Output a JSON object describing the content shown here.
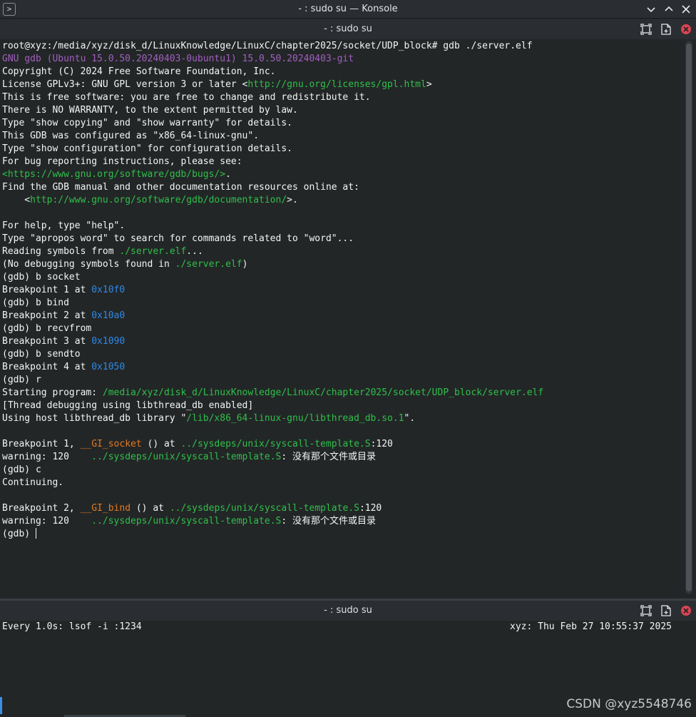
{
  "window": {
    "title": "- : sudo su — Konsole",
    "app_icon": "terminal-icon",
    "app_icon_glyph": ">",
    "buttons": [
      "minimize-icon",
      "maximize-icon",
      "close-icon"
    ]
  },
  "top_pane": {
    "title": "- : sudo su",
    "buttons": [
      "maximize-pane-icon",
      "split-pane-icon",
      "close-pane-icon"
    ],
    "lines": [
      [
        {
          "t": "root@xyz:/media/xyz/disk_d/LinuxKnowledge/LinuxC/chapter2025/socket/UDP_block# gdb ./server.elf"
        }
      ],
      [
        {
          "t": "GNU gdb (Ubuntu 15.0.50.20240403-0ubuntu1) 15.0.50.20240403-git",
          "c": "purple"
        }
      ],
      [
        {
          "t": "Copyright (C) 2024 Free Software Foundation, Inc."
        }
      ],
      [
        {
          "t": "License GPLv3+: GNU GPL version 3 or later <"
        },
        {
          "t": "http://gnu.org/licenses/gpl.html",
          "c": "green"
        },
        {
          "t": ">"
        }
      ],
      [
        {
          "t": "This is free software: you are free to change and redistribute it."
        }
      ],
      [
        {
          "t": "There is NO WARRANTY, to the extent permitted by law."
        }
      ],
      [
        {
          "t": "Type \"show copying\" and \"show warranty\" for details."
        }
      ],
      [
        {
          "t": "This GDB was configured as \"x86_64-linux-gnu\"."
        }
      ],
      [
        {
          "t": "Type \"show configuration\" for configuration details."
        }
      ],
      [
        {
          "t": "For bug reporting instructions, please see:"
        }
      ],
      [
        {
          "t": "<https://www.gnu.org/software/gdb/bugs/>",
          "c": "green"
        },
        {
          "t": "."
        }
      ],
      [
        {
          "t": "Find the GDB manual and other documentation resources online at:"
        }
      ],
      [
        {
          "t": "    <"
        },
        {
          "t": "http://www.gnu.org/software/gdb/documentation/",
          "c": "green"
        },
        {
          "t": ">."
        }
      ],
      [
        {
          "t": ""
        }
      ],
      [
        {
          "t": "For help, type \"help\"."
        }
      ],
      [
        {
          "t": "Type \"apropos word\" to search for commands related to \"word\"..."
        }
      ],
      [
        {
          "t": "Reading symbols from "
        },
        {
          "t": "./server.elf",
          "c": "green"
        },
        {
          "t": "..."
        }
      ],
      [
        {
          "t": "(No debugging symbols found in "
        },
        {
          "t": "./server.elf",
          "c": "green"
        },
        {
          "t": ")"
        }
      ],
      [
        {
          "t": "(gdb) b socket"
        }
      ],
      [
        {
          "t": "Breakpoint 1 at "
        },
        {
          "t": "0x10f0",
          "c": "blue"
        }
      ],
      [
        {
          "t": "(gdb) b bind"
        }
      ],
      [
        {
          "t": "Breakpoint 2 at "
        },
        {
          "t": "0x10a0",
          "c": "blue"
        }
      ],
      [
        {
          "t": "(gdb) b recvfrom"
        }
      ],
      [
        {
          "t": "Breakpoint 3 at "
        },
        {
          "t": "0x1090",
          "c": "blue"
        }
      ],
      [
        {
          "t": "(gdb) b sendto"
        }
      ],
      [
        {
          "t": "Breakpoint 4 at "
        },
        {
          "t": "0x1050",
          "c": "blue"
        }
      ],
      [
        {
          "t": "(gdb) r"
        }
      ],
      [
        {
          "t": "Starting program: "
        },
        {
          "t": "/media/xyz/disk_d/LinuxKnowledge/LinuxC/chapter2025/socket/UDP_block/server.elf",
          "c": "green"
        }
      ],
      [
        {
          "t": "[Thread debugging using libthread_db enabled]"
        }
      ],
      [
        {
          "t": "Using host libthread_db library \""
        },
        {
          "t": "/lib/x86_64-linux-gnu/libthread_db.so.1",
          "c": "green"
        },
        {
          "t": "\"."
        }
      ],
      [
        {
          "t": ""
        }
      ],
      [
        {
          "t": "Breakpoint 1, "
        },
        {
          "t": "__GI_socket",
          "c": "orange"
        },
        {
          "t": " () at "
        },
        {
          "t": "../sysdeps/unix/syscall-template.S",
          "c": "green"
        },
        {
          "t": ":120"
        }
      ],
      [
        {
          "t": "warning: 120    "
        },
        {
          "t": "../sysdeps/unix/syscall-template.S",
          "c": "green"
        },
        {
          "t": ": 没有那个文件或目录"
        }
      ],
      [
        {
          "t": "(gdb) c"
        }
      ],
      [
        {
          "t": "Continuing."
        }
      ],
      [
        {
          "t": ""
        }
      ],
      [
        {
          "t": "Breakpoint 2, "
        },
        {
          "t": "__GI_bind",
          "c": "orange"
        },
        {
          "t": " () at "
        },
        {
          "t": "../sysdeps/unix/syscall-template.S",
          "c": "green"
        },
        {
          "t": ":120"
        }
      ],
      [
        {
          "t": "warning: 120    "
        },
        {
          "t": "../sysdeps/unix/syscall-template.S",
          "c": "green"
        },
        {
          "t": ": 没有那个文件或目录"
        }
      ],
      [
        {
          "t": "(gdb) ",
          "cursor": true
        }
      ]
    ]
  },
  "bottom_pane": {
    "title": "- : sudo su",
    "buttons": [
      "maximize-pane-icon",
      "split-pane-icon",
      "close-pane-icon"
    ],
    "watch_command": "Every 1.0s: lsof -i :1234",
    "watch_status": "xyz: Thu Feb 27 10:55:37 2025"
  },
  "watermark": "CSDN @xyz5548746",
  "colors": {
    "purple": "#a05fbf",
    "green": "#2ec04a",
    "blue": "#2d8ae8",
    "orange": "#e07a1f",
    "close_red": "#da4453"
  }
}
